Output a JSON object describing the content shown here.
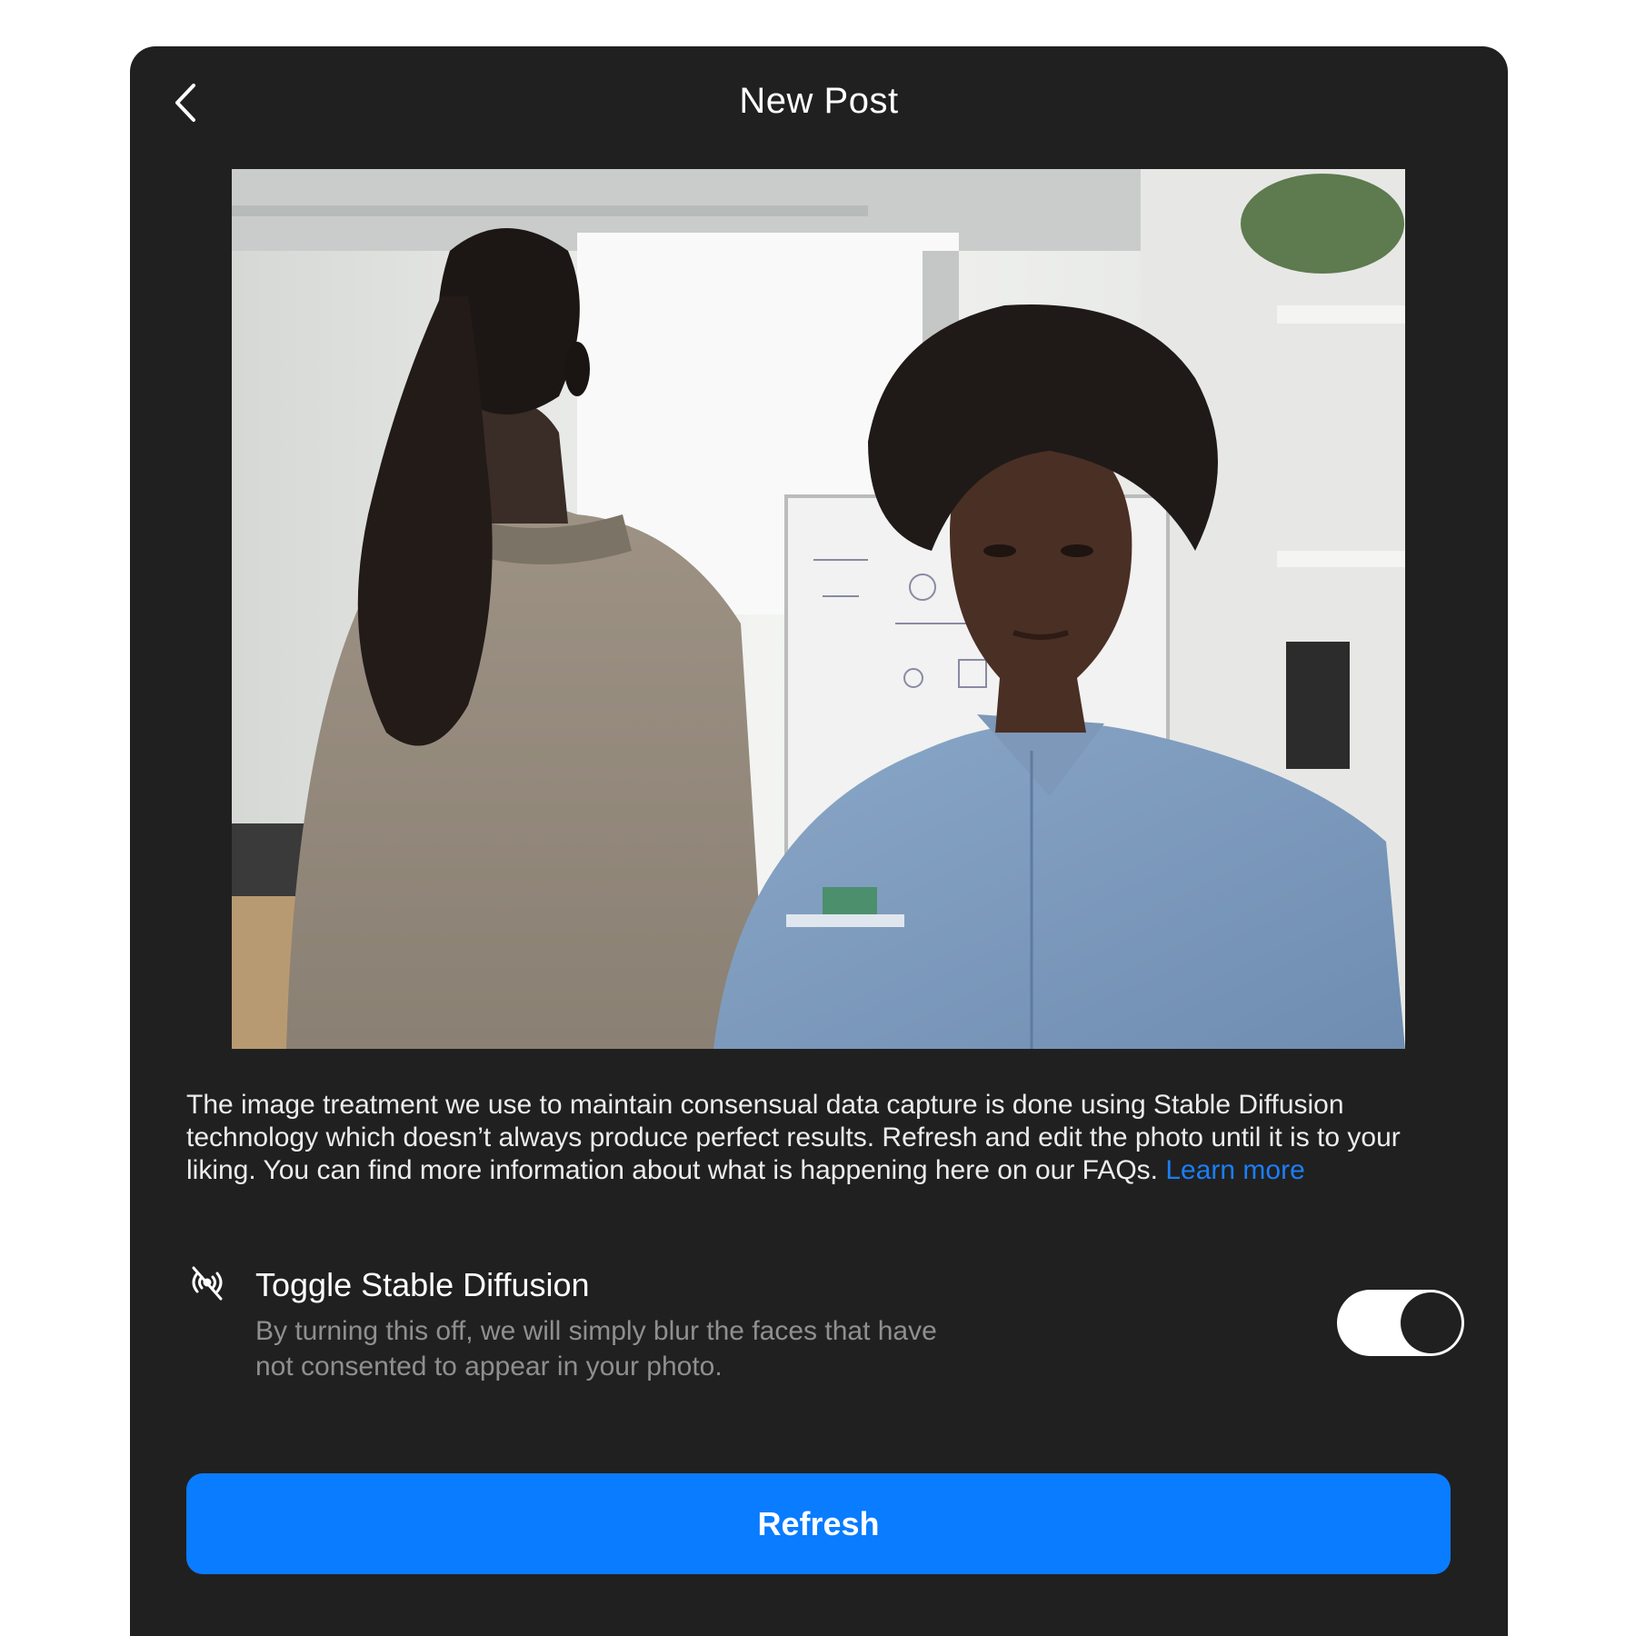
{
  "header": {
    "title": "New Post",
    "back_icon": "chevron-left-icon"
  },
  "photo": {
    "description": "Office photo: person with long braided hair facing away, person in denim shirt facing camera"
  },
  "description": {
    "text": "The image treatment we use to maintain consensual data capture is done using Stable Diffusion technology which doesn’t always produce perfect results. Refresh and edit the photo until it is to your liking. You can find more information about what is happening here on our FAQs. ",
    "link_label": "Learn more"
  },
  "stable_diffusion": {
    "icon": "signal-off-icon",
    "title": "Toggle Stable Diffusion",
    "subtitle": "By turning this off, we will simply blur the faces that have not consented to appear in your photo.",
    "enabled": true
  },
  "actions": {
    "refresh_label": "Refresh"
  },
  "colors": {
    "panel_bg": "#202020",
    "accent": "#0a7cff",
    "link": "#1a7ef6"
  }
}
